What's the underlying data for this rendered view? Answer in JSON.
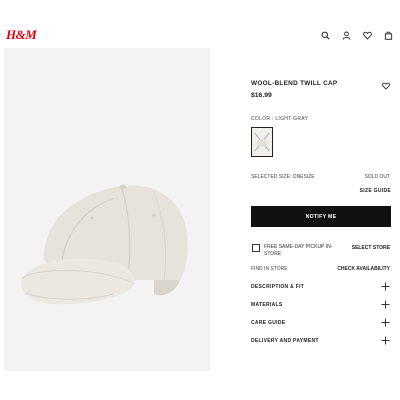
{
  "header": {
    "logo": "H&M",
    "icons": [
      "search-icon",
      "account-icon",
      "favorites-icon",
      "cart-icon"
    ]
  },
  "product": {
    "title": "WOOL-BLEND TWILL CAP",
    "price": "$16.99",
    "color_label": "COLOR : LIGHT GRAY",
    "selected_size": "SELECTED SIZE: ONESIZE",
    "availability": "SOLD OUT",
    "size_guide": "SIZE GUIDE",
    "notify_button": "NOTIFY ME",
    "pickup_label": "FREE SAME-DAY PICKUP IN-STORE",
    "select_store": "SELECT STORE",
    "find_in_store": "FIND IN STORE",
    "check_availability": "CHECK AVAILABILITY"
  },
  "accordion": [
    {
      "label": "DESCRIPTION & FIT"
    },
    {
      "label": "MATERIALS"
    },
    {
      "label": "CARE GUIDE"
    },
    {
      "label": "DELIVERY AND PAYMENT"
    }
  ],
  "colors": {
    "brand": "#e50010",
    "button_bg": "#111111",
    "image_bg": "#f3f3f3",
    "cap": "#e6e3dc"
  }
}
